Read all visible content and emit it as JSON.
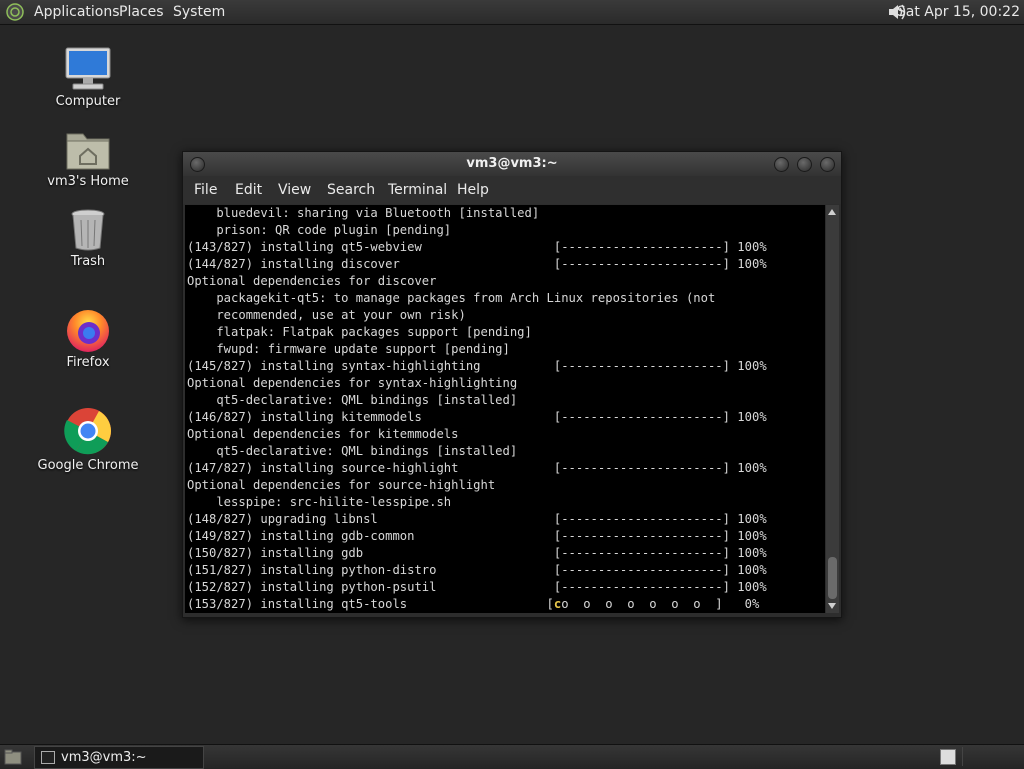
{
  "top_panel": {
    "menus": [
      "Applications",
      "Places",
      "System"
    ],
    "clock": "Sat Apr 15, 00:22",
    "logo_icon": "distro-logo-icon",
    "volume_icon": "speaker-icon"
  },
  "desktop_icons": [
    {
      "label": "Computer",
      "icon": "computer-icon"
    },
    {
      "label": "vm3's Home",
      "icon": "home-folder-icon"
    },
    {
      "label": "Trash",
      "icon": "trash-icon"
    },
    {
      "label": "Firefox",
      "icon": "firefox-icon"
    },
    {
      "label": "Google Chrome",
      "icon": "chrome-icon"
    }
  ],
  "terminal": {
    "title": "vm3@vm3:~",
    "menus": [
      "File",
      "Edit",
      "View",
      "Search",
      "Terminal",
      "Help"
    ],
    "lines": [
      "    bluedevil: sharing via Bluetooth [installed]",
      "    prison: QR code plugin [pending]",
      "(143/827) installing qt5-webview                  [----------------------] 100%",
      "(144/827) installing discover                     [----------------------] 100%",
      "Optional dependencies for discover",
      "    packagekit-qt5: to manage packages from Arch Linux repositories (not",
      "    recommended, use at your own risk)",
      "    flatpak: Flatpak packages support [pending]",
      "    fwupd: firmware update support [pending]",
      "(145/827) installing syntax-highlighting          [----------------------] 100%",
      "Optional dependencies for syntax-highlighting",
      "    qt5-declarative: QML bindings [installed]",
      "(146/827) installing kitemmodels                  [----------------------] 100%",
      "Optional dependencies for kitemmodels",
      "    qt5-declarative: QML bindings [installed]",
      "(147/827) installing source-highlight             [----------------------] 100%",
      "Optional dependencies for source-highlight",
      "    lesspipe: src-hilite-lesspipe.sh",
      "(148/827) upgrading libnsl                        [----------------------] 100%",
      "(149/827) installing gdb-common                   [----------------------] 100%",
      "(150/827) installing gdb                          [----------------------] 100%",
      "(151/827) installing python-distro                [----------------------] 100%",
      "(152/827) installing python-psutil                [----------------------] 100%"
    ],
    "last_line_prefix": "(153/827) installing qt5-tools                   [",
    "last_line_cursor": "c",
    "last_line_suffix": "o  o  o  o  o  o  o  ]   0%"
  },
  "taskbar": {
    "task_label": "vm3@vm3:~",
    "show_desktop_icon": "show-desktop-icon"
  }
}
